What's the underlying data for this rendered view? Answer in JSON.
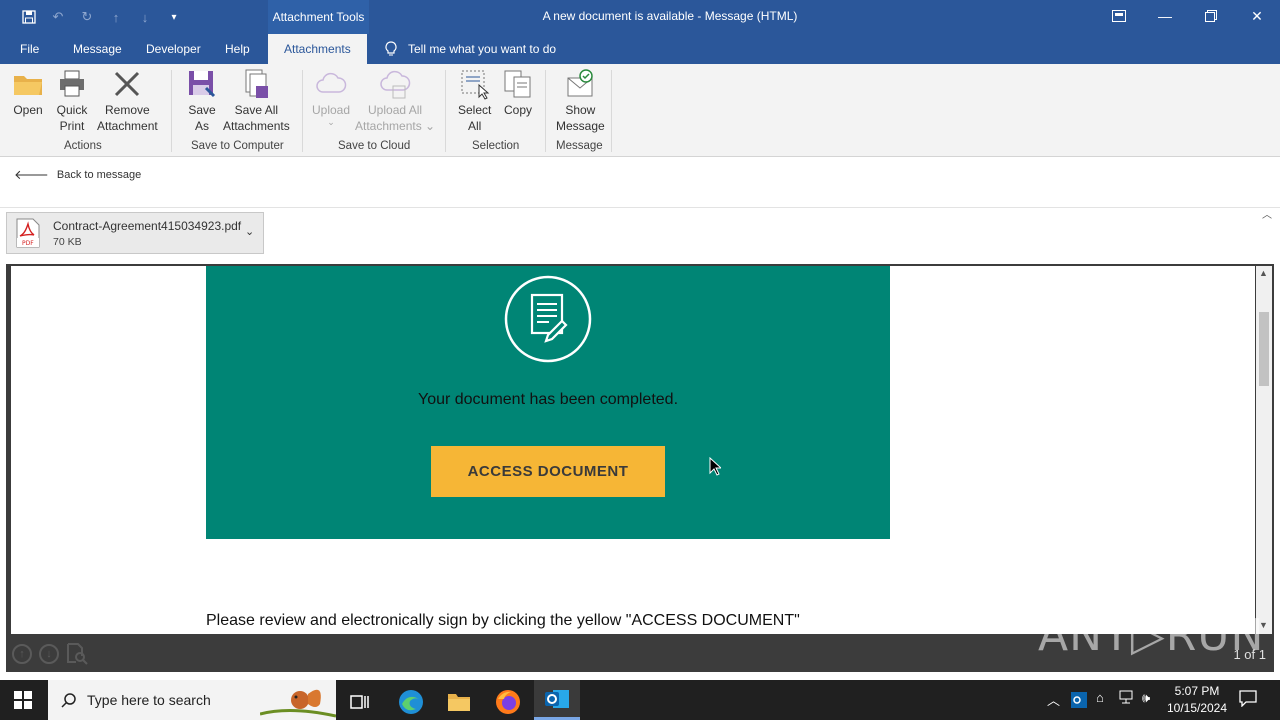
{
  "window": {
    "title": "A new document is available  -  Message (HTML)",
    "context_tab": "Attachment Tools"
  },
  "menu": {
    "tabs": [
      "File",
      "Message",
      "Developer",
      "Help",
      "Attachments"
    ],
    "tell_me": "Tell me what you want to do"
  },
  "ribbon": {
    "groups": {
      "actions": "Actions",
      "save_to_computer": "Save to Computer",
      "save_to_cloud": "Save to Cloud",
      "selection": "Selection",
      "message": "Message"
    },
    "buttons": {
      "open": "Open",
      "quick_print_1": "Quick",
      "quick_print_2": "Print",
      "remove_1": "Remove",
      "remove_2": "Attachment",
      "save_as_1": "Save",
      "save_as_2": "As",
      "save_all_1": "Save All",
      "save_all_2": "Attachments",
      "upload": "Upload",
      "upload_all_1": "Upload All",
      "upload_all_2": "Attachments",
      "select_all_1": "Select",
      "select_all_2": "All",
      "copy": "Copy",
      "show_message_1": "Show",
      "show_message_2": "Message"
    }
  },
  "back_link": "Back to message",
  "attachment": {
    "name": "Contract-Agreement415034923.pdf",
    "size": "70 KB",
    "icon_label": "PDF"
  },
  "document": {
    "completed_text": "Your document has been completed.",
    "button_label": "ACCESS DOCUMENT",
    "review_text": "Please review and electronically sign by clicking the yellow \"ACCESS DOCUMENT\""
  },
  "viewer": {
    "page_count": "1 of 1"
  },
  "watermark": "ANY▷RUN",
  "taskbar": {
    "search_placeholder": "Type here to search",
    "time": "5:07 PM",
    "date": "10/15/2024"
  },
  "colors": {
    "title_blue": "#2b579a",
    "teal": "#008575",
    "button_yellow": "#f6b636"
  }
}
